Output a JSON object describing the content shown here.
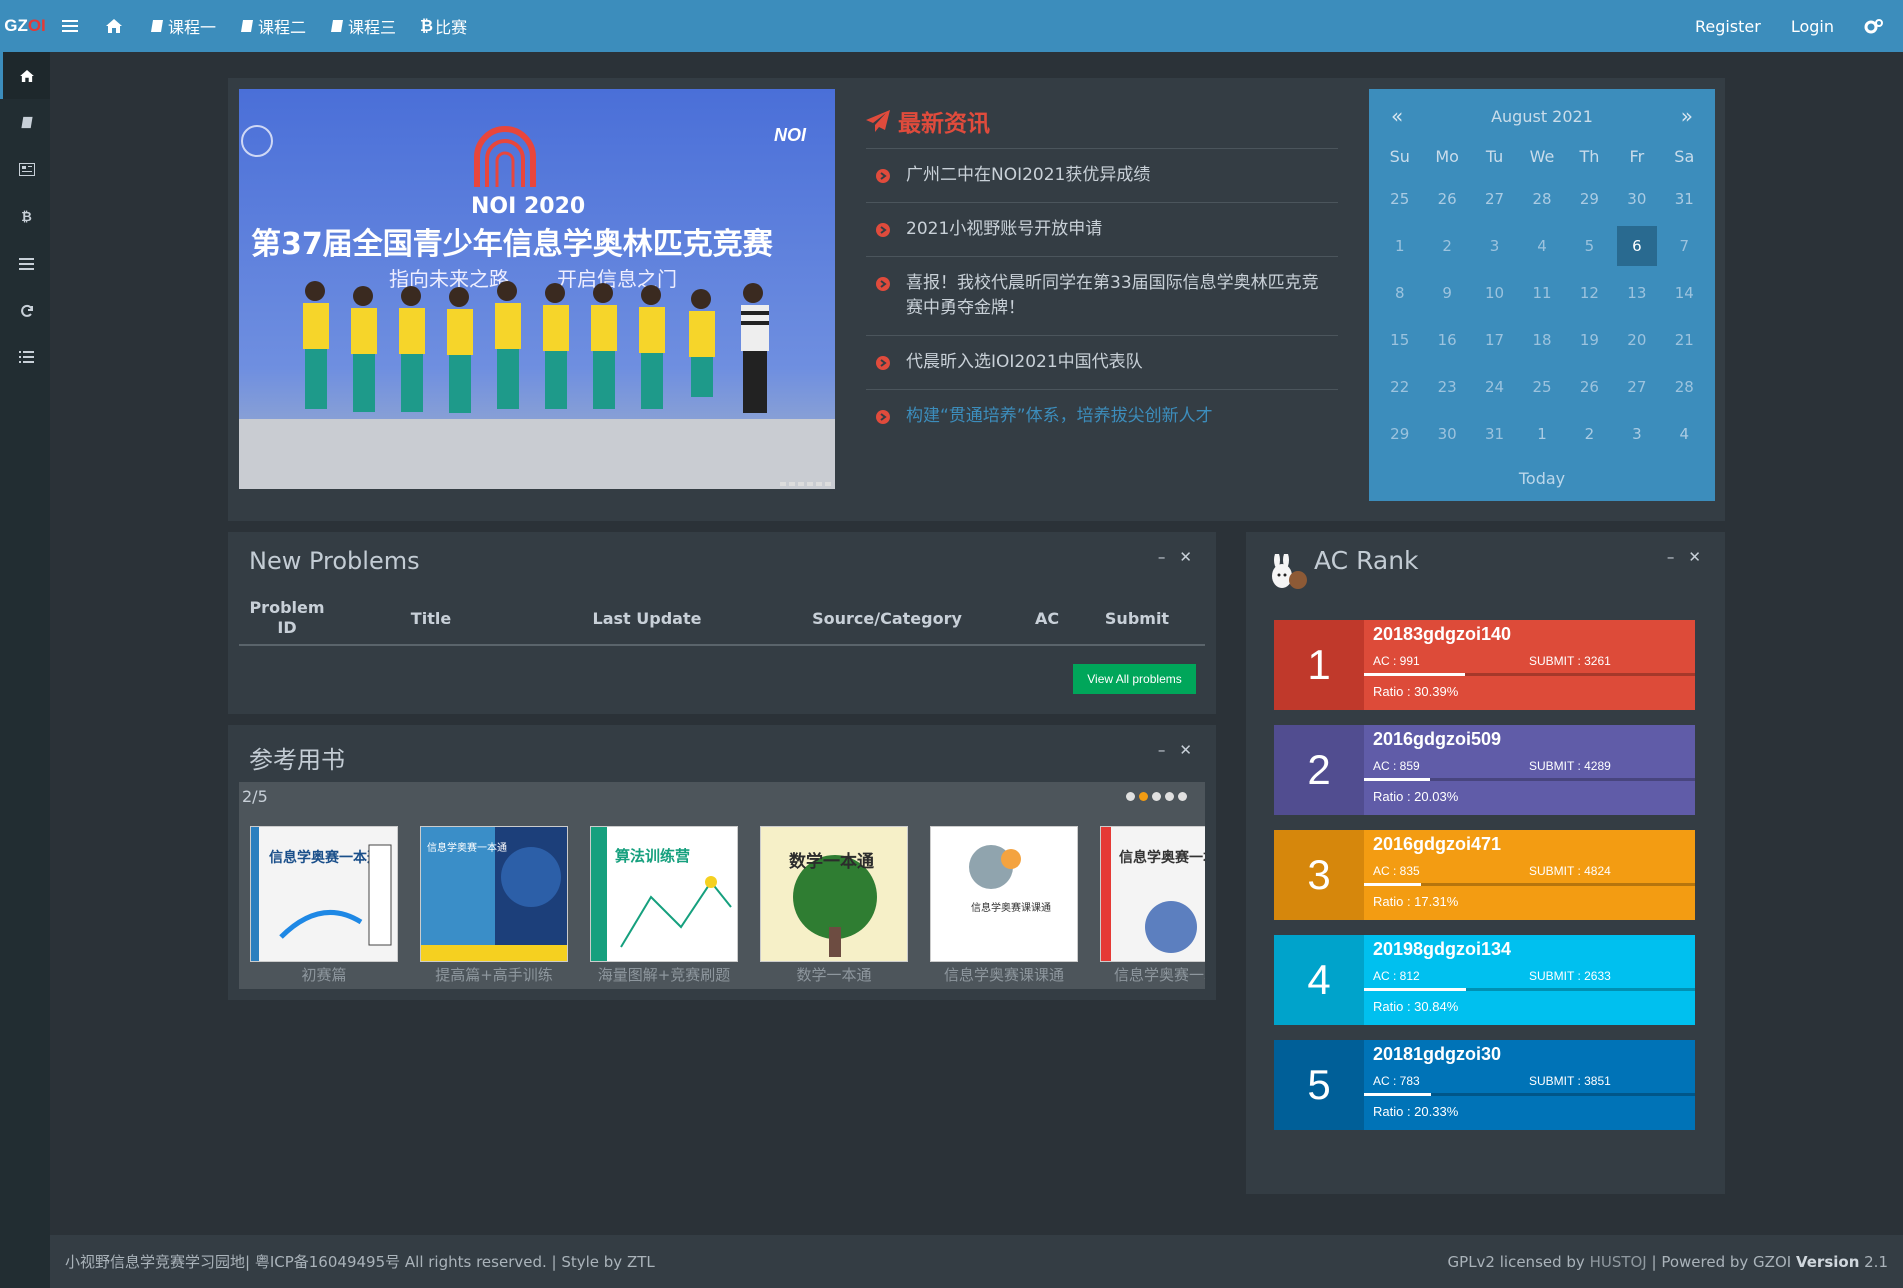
{
  "nav": {
    "logo_gz": "GZ",
    "logo_oi": "OI",
    "items": [
      {
        "label": "课程一"
      },
      {
        "label": "课程二"
      },
      {
        "label": "课程三"
      },
      {
        "label": "比赛"
      }
    ],
    "register": "Register",
    "login": "Login"
  },
  "news": {
    "title": "最新资讯",
    "items": [
      "广州二中在NOI2021获优异成绩",
      "2021小视野账号开放申请",
      "喜报！我校代晨昕同学在第33届国际信息学奥林匹克竞赛中勇夺金牌！",
      "代晨昕入选IOI2021中国代表队",
      "构建“贯通培养”体系，培养拔尖创新人才"
    ]
  },
  "banner": {
    "year": "NOI 2020",
    "headline": "第37届全国青少年信息学奥林匹克竞赛",
    "slogan_left": "指向未来之路",
    "slogan_right": "开启信息之门",
    "noi_mark": "NOI"
  },
  "calendar": {
    "prev": "«",
    "next": "»",
    "month": "August 2021",
    "dows": [
      "Su",
      "Mo",
      "Tu",
      "We",
      "Th",
      "Fr",
      "Sa"
    ],
    "days": [
      "25",
      "26",
      "27",
      "28",
      "29",
      "30",
      "31",
      "1",
      "2",
      "3",
      "4",
      "5",
      "6",
      "7",
      "8",
      "9",
      "10",
      "11",
      "12",
      "13",
      "14",
      "15",
      "16",
      "17",
      "18",
      "19",
      "20",
      "21",
      "22",
      "23",
      "24",
      "25",
      "26",
      "27",
      "28",
      "29",
      "30",
      "31",
      "1",
      "2",
      "3",
      "4"
    ],
    "today": "Today"
  },
  "new_problems": {
    "title": "New Problems",
    "columns": [
      "Problem ID",
      "Title",
      "Last Update",
      "Source/Category",
      "AC",
      "Submit"
    ],
    "view_all": "View All problems"
  },
  "books": {
    "title": "参考用书",
    "count": "2/5",
    "items": [
      {
        "label": "初赛篇",
        "cover": "信息学奥赛一本通"
      },
      {
        "label": "提高篇+高手训练",
        "cover": "信息学奥赛一本通"
      },
      {
        "label": "海量图解+竞赛刷题",
        "cover": "算法训练营"
      },
      {
        "label": "数学一本通",
        "cover": "数学一本通"
      },
      {
        "label": "信息学奥赛课课通",
        "cover": "信息学奥赛课课通"
      },
      {
        "label": "信息学奥赛一本通",
        "cover": "信息学奥赛一本通"
      }
    ]
  },
  "ac_rank": {
    "title": "AC Rank",
    "entries": [
      {
        "rank": "1",
        "name": "20183gdgzoi140",
        "ac": "AC : 991",
        "submit": "SUBMIT : 3261",
        "ratio": "Ratio : 30.39%",
        "ratio_value": 30.39,
        "color": "#dd4b39",
        "dark": "#c0392b"
      },
      {
        "rank": "2",
        "name": "2016gdgzoi509",
        "ac": "AC : 859",
        "submit": "SUBMIT : 4289",
        "ratio": "Ratio : 20.03%",
        "ratio_value": 20.03,
        "color": "#605ca8",
        "dark": "#514d90"
      },
      {
        "rank": "3",
        "name": "2016gdgzoi471",
        "ac": "AC : 835",
        "submit": "SUBMIT : 4824",
        "ratio": "Ratio : 17.31%",
        "ratio_value": 17.31,
        "color": "#f39c12",
        "dark": "#d6870c"
      },
      {
        "rank": "4",
        "name": "20198gdgzoi134",
        "ac": "AC : 812",
        "submit": "SUBMIT : 2633",
        "ratio": "Ratio : 30.84%",
        "ratio_value": 30.84,
        "color": "#00c0ef",
        "dark": "#00a3cb"
      },
      {
        "rank": "5",
        "name": "20181gdgzoi30",
        "ac": "AC : 783",
        "submit": "SUBMIT : 3851",
        "ratio": "Ratio : 20.33%",
        "ratio_value": 20.33,
        "color": "#0073b7",
        "dark": "#005f98"
      }
    ]
  },
  "footer": {
    "left_cn": "小视野信息学竞赛学习园地| 粤ICP备16049495号",
    "left_en": " All rights reserved. | Style by ZTL",
    "right_a": "GPLv2 licensed by ",
    "right_hus": "HUSTOJ",
    "right_b": " | Powered by GZOI ",
    "right_ver": "Version",
    "right_num": " 2.1"
  },
  "colors": {
    "primary": "#3c8dbc",
    "bg": "#2b3238",
    "box": "#343d44",
    "news_red": "#e04b3c",
    "green": "#00a65a"
  }
}
